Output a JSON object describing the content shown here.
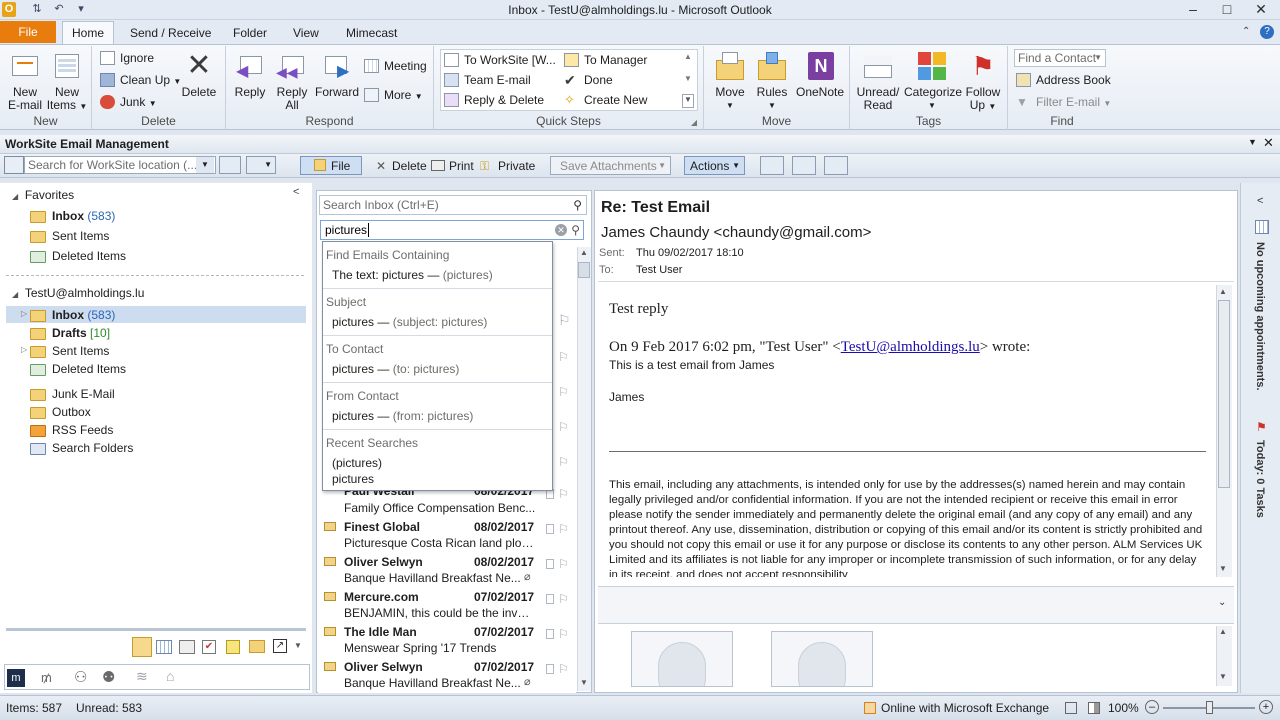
{
  "window": {
    "title": "Inbox - TestU@almholdings.lu - Microsoft Outlook"
  },
  "tabs": [
    "File",
    "Home",
    "Send / Receive",
    "Folder",
    "View",
    "Mimecast"
  ],
  "ribbon": {
    "new": {
      "group": "New",
      "new_email": [
        "New",
        "E-mail"
      ],
      "new_items": [
        "New",
        "Items"
      ]
    },
    "delete": {
      "group": "Delete",
      "ignore": "Ignore",
      "clean_up": "Clean Up",
      "junk": "Junk",
      "delete": "Delete"
    },
    "respond": {
      "group": "Respond",
      "reply": "Reply",
      "reply_all": [
        "Reply",
        "All"
      ],
      "forward": "Forward",
      "meeting": "Meeting",
      "more": "More"
    },
    "quicksteps": {
      "group": "Quick Steps",
      "items": [
        "To WorkSite [W...",
        "To Manager",
        "Team E-mail",
        "Done",
        "Reply & Delete",
        "Create New"
      ]
    },
    "move": {
      "group": "Move",
      "move": "Move",
      "rules": "Rules",
      "onenote": "OneNote"
    },
    "tags": {
      "group": "Tags",
      "unread": [
        "Unread/",
        "Read"
      ],
      "categorize": "Categorize",
      "follow_up": [
        "Follow",
        "Up"
      ]
    },
    "find": {
      "group": "Find",
      "find_contact": "Find a Contact",
      "address_book": "Address Book",
      "filter_email": "Filter E-mail"
    }
  },
  "worksite": {
    "title": "WorkSite Email Management",
    "search_placeholder": "Search for WorkSite location (...",
    "file": "File",
    "delete": "Delete",
    "print": "Print",
    "private": "Private",
    "save_attachments": "Save Attachments",
    "actions": "Actions"
  },
  "nav": {
    "favorites_label": "Favorites",
    "favorites": [
      {
        "name": "Inbox",
        "count": "(583)"
      },
      {
        "name": "Sent Items",
        "count": ""
      },
      {
        "name": "Deleted Items",
        "count": ""
      }
    ],
    "account": "TestU@almholdings.lu",
    "folders": [
      {
        "name": "Inbox",
        "count": "(583)"
      },
      {
        "name": "Drafts",
        "count": "[10]"
      },
      {
        "name": "Sent Items",
        "count": ""
      },
      {
        "name": "Deleted Items",
        "count": ""
      },
      {
        "name": "Junk E-Mail",
        "count": ""
      },
      {
        "name": "Outbox",
        "count": ""
      },
      {
        "name": "RSS Feeds",
        "count": ""
      },
      {
        "name": "Search Folders",
        "count": ""
      }
    ]
  },
  "search": {
    "placeholder": "Search Inbox (Ctrl+E)",
    "query": "pictures",
    "suggestions": {
      "h1": "Find Emails Containing",
      "i1a": "The text: pictures",
      "i1b": "(pictures)",
      "h2": "Subject",
      "i2a": "pictures",
      "i2b": "(subject: pictures)",
      "h3": "To Contact",
      "i3a": "pictures",
      "i3b": "(to: pictures)",
      "h4": "From Contact",
      "i4a": "pictures",
      "i4b": "(from: pictures)",
      "h5": "Recent Searches",
      "r1": "(pictures)",
      "r2": "pictures"
    }
  },
  "messages": [
    {
      "sender": "Paul Westall",
      "date": "08/02/2017",
      "subject": "Family Office Compensation Benc..."
    },
    {
      "sender": "Finest Global",
      "date": "08/02/2017",
      "subject": "Picturesque Costa Rican land plots..."
    },
    {
      "sender": "Oliver Selwyn",
      "date": "08/02/2017",
      "subject": "Banque Havilland Breakfast Ne..."
    },
    {
      "sender": "Mercure.com",
      "date": "07/02/2017",
      "subject": "BENJAMIN, this could be the inven..."
    },
    {
      "sender": "The Idle Man",
      "date": "07/02/2017",
      "subject": "Menswear Spring '17 Trends"
    },
    {
      "sender": "Oliver Selwyn",
      "date": "07/02/2017",
      "subject": "Banque Havilland Breakfast Ne..."
    }
  ],
  "reading": {
    "subject": "Re: Test Email",
    "from": "James Chaundy <chaundy@gmail.com>",
    "sent_label": "Sent:",
    "sent": "Thu 09/02/2017 18:10",
    "to_label": "To:",
    "to": "Test User",
    "body_reply": "Test reply",
    "quote_prefix": "On 9 Feb 2017 6:02 pm, \"Test User\" <",
    "quote_link": "TestU@almholdings.lu",
    "quote_suffix": "> wrote:",
    "quote_line": "This is a test email from James",
    "sign": "James",
    "disclaimer": "This email, including any attachments, is intended only for use by the addresses(s) named herein and may contain legally privileged and/or confidential information. If you are not the intended recipient or receive this email in error please notify the sender immediately and permanently delete the original email (and any copy of any email) and any printout thereof. Any use, dissemination, distribution or copying of this email and/or its content is strictly prohibited and you should not copy this email or use it for any purpose or disclose its contents to any other person. ALM Services UK Limited and its affiliates is not liable for any improper or incomplete transmission of such information, or for any delay in its receipt, and does not accept responsibility"
  },
  "todo": {
    "appointments": "No upcoming appointments.",
    "tasks": "Today: 0 Tasks"
  },
  "status": {
    "items": "Items: 587",
    "unread": "Unread: 583",
    "connection": "Online with Microsoft Exchange",
    "zoom": "100%"
  }
}
